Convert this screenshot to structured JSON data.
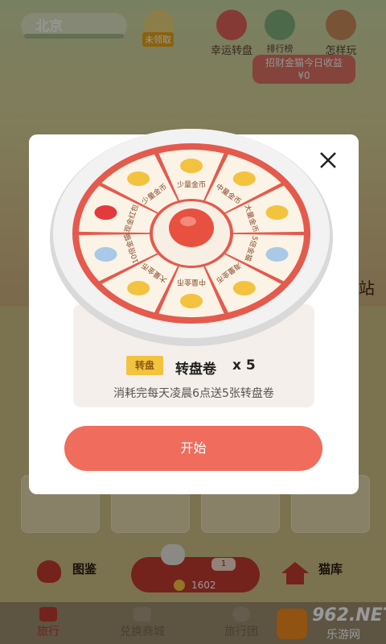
{
  "topbar": {
    "location": "北京",
    "buttons": [
      {
        "label": "未领取"
      },
      {
        "label": "幸运转盘"
      },
      {
        "label": "排行榜"
      },
      {
        "label": "怎样玩"
      }
    ],
    "income_line1": "招财金猫今日收益",
    "income_line2": "¥0"
  },
  "background": {
    "station_text": "站"
  },
  "modal": {
    "wheel_segments": [
      "少量金币",
      "中量金币",
      "大量金币",
      "5倍金猫",
      "海量金币",
      "中量金币",
      "大量金币",
      "10倍金猫",
      "现金红包",
      "少量金币"
    ],
    "ticket_badge": "转盘",
    "ticket_name": "转盘卷",
    "ticket_count": "x 5",
    "ticket_desc": "消耗完每天凌晨6点送5张转盘卷",
    "start_label": "开始"
  },
  "bottom": {
    "left_action": "图鉴",
    "right_action": "猫库",
    "coin_value": "1602",
    "level_value": "1"
  },
  "tabs": [
    {
      "label": "旅行"
    },
    {
      "label": "兑换商城"
    },
    {
      "label": "旅行团"
    }
  ],
  "watermark": {
    "main": "962.NET",
    "sub": "乐游网"
  },
  "colors": {
    "accent": "#f06c5c",
    "wheel_rim": "#e8e8e8",
    "wheel_inner": "#e45a4d",
    "badge": "#f3c33f"
  }
}
